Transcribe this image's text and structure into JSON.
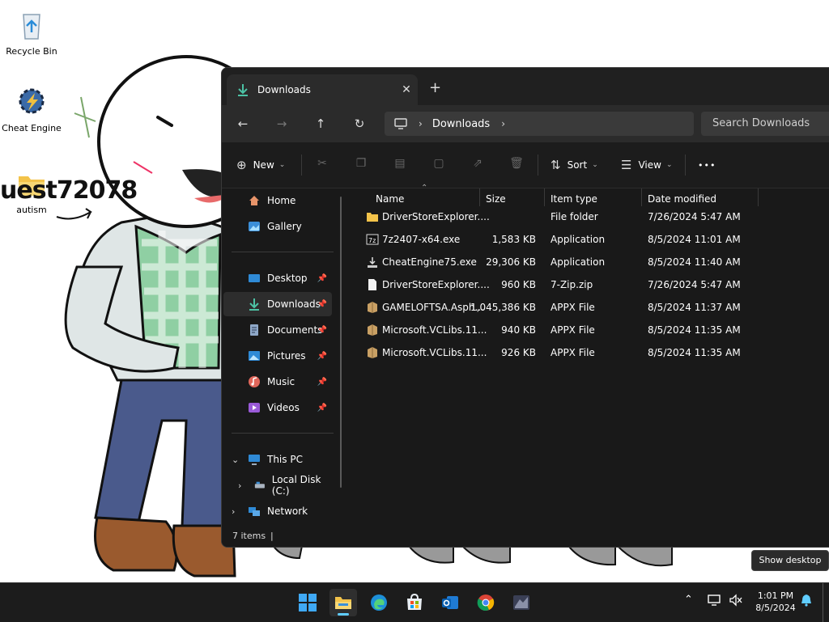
{
  "desktop": {
    "icons": [
      {
        "label": "Recycle Bin"
      },
      {
        "label": "Cheat Engine"
      },
      {
        "label": "autism"
      }
    ],
    "wallpaper_text": "uest72078"
  },
  "window": {
    "tab_title": "Downloads",
    "tab_close": "✕",
    "new_tab": "+",
    "breadcrumb": "Downloads",
    "search_placeholder": "Search Downloads",
    "toolbar": {
      "new_label": "New",
      "sort_label": "Sort",
      "view_label": "View",
      "more": "•••"
    },
    "nav": {
      "home": "Home",
      "gallery": "Gallery",
      "desktop": "Desktop",
      "downloads": "Downloads",
      "documents": "Documents",
      "pictures": "Pictures",
      "music": "Music",
      "videos": "Videos",
      "this_pc": "This PC",
      "local_disk": "Local Disk (C:)",
      "network": "Network"
    },
    "columns": {
      "name": "Name",
      "size": "Size",
      "type": "Item type",
      "date": "Date modified"
    },
    "files": [
      {
        "name": "DriverStoreExplorer....",
        "size": "",
        "type": "File folder",
        "date": "7/26/2024 5:47 AM",
        "icon": "folder-icon"
      },
      {
        "name": "7z2407-x64.exe",
        "size": "1,583 KB",
        "type": "Application",
        "date": "8/5/2024 11:01 AM",
        "icon": "7zip-installer-icon"
      },
      {
        "name": "CheatEngine75.exe",
        "size": "29,306 KB",
        "type": "Application",
        "date": "8/5/2024 11:40 AM",
        "icon": "installer-icon"
      },
      {
        "name": "DriverStoreExplorer....",
        "size": "960 KB",
        "type": "7-Zip.zip",
        "date": "7/26/2024 5:47 AM",
        "icon": "zip-file-icon"
      },
      {
        "name": "GAMELOFTSA.Asph...",
        "size": "1,045,386 KB",
        "type": "APPX File",
        "date": "8/5/2024 11:37 AM",
        "icon": "appx-package-icon"
      },
      {
        "name": "Microsoft.VCLibs.11...",
        "size": "940 KB",
        "type": "APPX File",
        "date": "8/5/2024 11:35 AM",
        "icon": "appx-package-icon"
      },
      {
        "name": "Microsoft.VCLibs.11...",
        "size": "926 KB",
        "type": "APPX File",
        "date": "8/5/2024 11:35 AM",
        "icon": "appx-package-icon"
      }
    ],
    "status": "7 items",
    "status_caret": "|"
  },
  "tooltip": "Show desktop",
  "taskbar": {
    "time": "1:01 PM",
    "date": "8/5/2024"
  },
  "colors": {
    "accent": "#60cdff",
    "folder": "#f3c34a",
    "window_bg": "#191919"
  }
}
